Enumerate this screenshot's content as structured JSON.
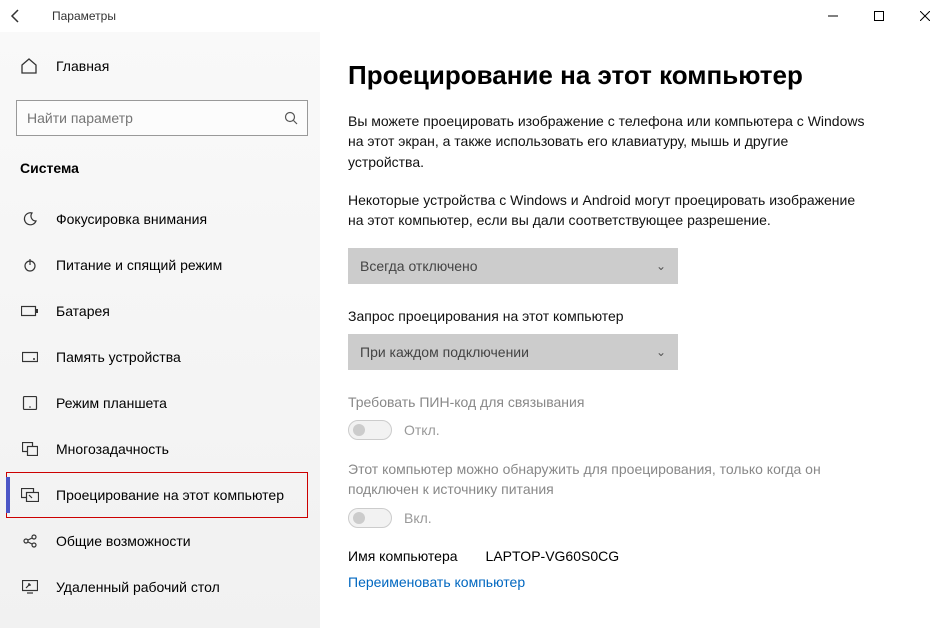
{
  "window": {
    "title": "Параметры"
  },
  "sidebar": {
    "home": "Главная",
    "search_placeholder": "Найти параметр",
    "category": "Система",
    "items": [
      {
        "icon": "focus",
        "label": "Фокусировка внимания"
      },
      {
        "icon": "power",
        "label": "Питание и спящий режим"
      },
      {
        "icon": "battery",
        "label": "Батарея"
      },
      {
        "icon": "storage",
        "label": "Память устройства"
      },
      {
        "icon": "tablet",
        "label": "Режим планшета"
      },
      {
        "icon": "multitask",
        "label": "Многозадачность"
      },
      {
        "icon": "project",
        "label": "Проецирование на этот компьютер",
        "selected": true
      },
      {
        "icon": "shared",
        "label": "Общие возможности"
      },
      {
        "icon": "remote",
        "label": "Удаленный рабочий стол"
      }
    ]
  },
  "main": {
    "heading": "Проецирование на этот компьютер",
    "desc1": "Вы можете проецировать изображение с телефона или компьютера с Windows на этот экран, а также использовать его клавиатуру, мышь и другие устройства.",
    "desc2": "Некоторые устройства с Windows и Android могут проецировать изображение на этот компьютер, если вы дали соответствующее разрешение.",
    "dropdown1": "Всегда отключено",
    "field2": "Запрос проецирования на этот компьютер",
    "dropdown2": "При каждом подключении",
    "pin_label": "Требовать ПИН-код для связывания",
    "pin_toggle_state": "Откл.",
    "discover_text": "Этот компьютер можно обнаружить для проецирования, только когда он подключен к источнику питания",
    "discover_toggle_state": "Вкл.",
    "pcname_label": "Имя компьютера",
    "pcname_value": "LAPTOP-VG60S0CG",
    "rename_link": "Переименовать компьютер"
  }
}
